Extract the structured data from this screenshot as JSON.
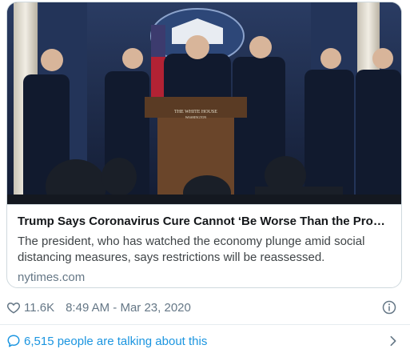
{
  "card": {
    "title": "Trump Says Coronavirus Cure Cannot ‘Be Worse Than the Probl…",
    "description": "The president, who has watched the economy plunge amid social distancing measures, says restrictions will be reassessed.",
    "domain": "nytimes.com",
    "image": {
      "lectern_text_line1": "THE WHITE HOUSE",
      "lectern_text_line2": "WASHINGTON"
    }
  },
  "meta": {
    "likes": "11.6K",
    "timestamp": "8:49 AM - Mar 23, 2020",
    "icons": [
      "heart-icon",
      "info-icon"
    ]
  },
  "talking": {
    "label": "6,515 people are talking about this",
    "icons": [
      "speech-bubble-icon",
      "chevron-right-icon"
    ]
  },
  "colors": {
    "link_blue": "#1b95e0",
    "muted_gray": "#657786",
    "border": "#cfd9de"
  }
}
